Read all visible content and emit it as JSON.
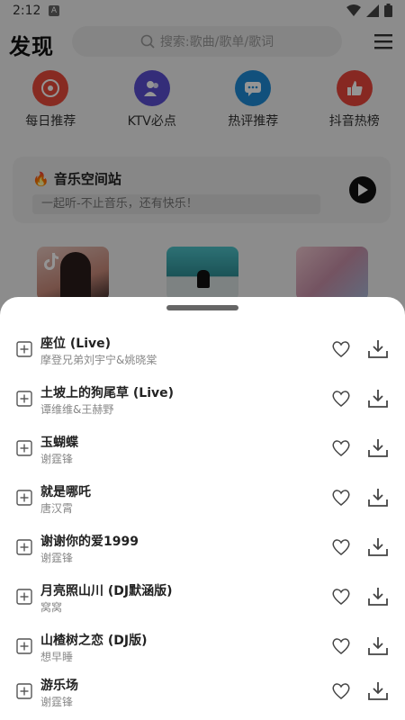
{
  "status_bar": {
    "time": "2:12"
  },
  "header": {
    "logo": "发现",
    "search_placeholder": "搜索:歌曲/歌单/歌词"
  },
  "features": [
    {
      "label": "每日推荐",
      "color": "#e84b3c",
      "icon": "disc-icon"
    },
    {
      "label": "KTV必点",
      "color": "#5a4fd1",
      "icon": "people-icon"
    },
    {
      "label": "热评推荐",
      "color": "#1e8bd6",
      "icon": "comment-icon"
    },
    {
      "label": "抖音热榜",
      "color": "#e8453c",
      "icon": "thumbs-up-icon"
    }
  ],
  "card": {
    "title": "音乐空间站",
    "subtitle": "一起听-不止音乐，还有快乐！"
  },
  "songs": [
    {
      "title": "座位 (Live)",
      "artist": "摩登兄弟刘宇宁&姚晓棠"
    },
    {
      "title": "土坡上的狗尾草 (Live)",
      "artist": "谭维维&王赫野"
    },
    {
      "title": "玉蝴蝶",
      "artist": "谢霆锋"
    },
    {
      "title": "就是哪吒",
      "artist": "唐汉霄"
    },
    {
      "title": "谢谢你的爱1999",
      "artist": "谢霆锋"
    },
    {
      "title": "月亮照山川 (DJ默涵版)",
      "artist": "窝窝"
    },
    {
      "title": "山楂树之恋 (DJ版)",
      "artist": "想早睡"
    },
    {
      "title": "游乐场",
      "artist": "谢霆锋"
    }
  ]
}
